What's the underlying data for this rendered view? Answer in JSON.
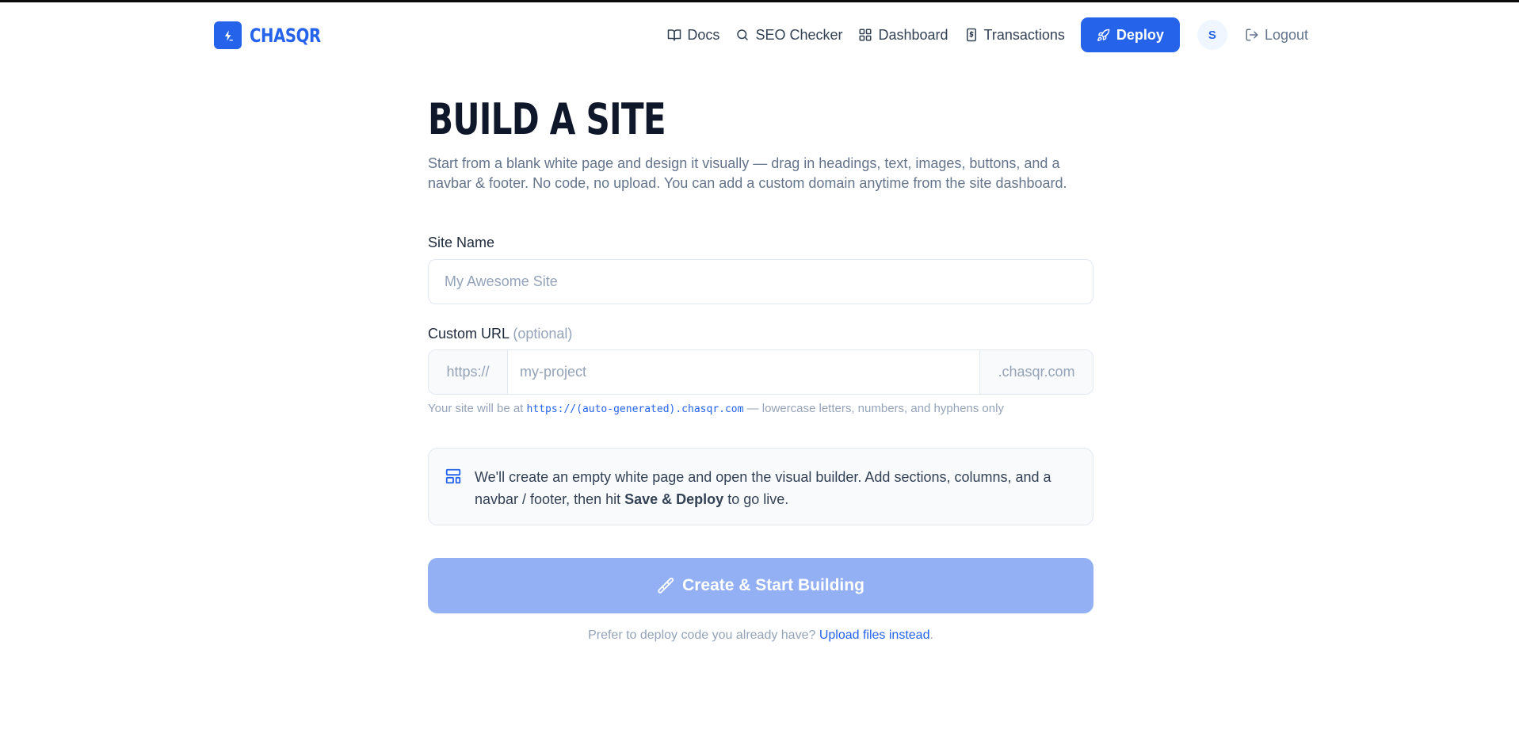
{
  "header": {
    "brand": "CHASQR",
    "nav": {
      "docs": "Docs",
      "seo": "SEO Checker",
      "dashboard": "Dashboard",
      "transactions": "Transactions",
      "deploy": "Deploy",
      "avatar_initial": "S",
      "logout": "Logout"
    }
  },
  "main": {
    "title": "BUILD A SITE",
    "subtitle": "Start from a blank white page and design it visually — drag in headings, text, images, buttons, and a navbar & footer. No code, no upload. You can add a custom domain anytime from the site dashboard.",
    "site_name": {
      "label": "Site Name",
      "placeholder": "My Awesome Site",
      "value": ""
    },
    "custom_url": {
      "label": "Custom URL",
      "optional": "(optional)",
      "prefix": "https://",
      "placeholder": "my-project",
      "value": "",
      "suffix": ".chasqr.com",
      "helper_before": "Your site will be at ",
      "helper_code": "https://(auto-generated).chasqr.com",
      "helper_after": " — lowercase letters, numbers, and hyphens only"
    },
    "info": {
      "text_before": "We'll create an empty white page and open the visual builder. Add sections, columns, and a navbar / footer, then hit ",
      "text_bold": "Save & Deploy",
      "text_after": " to go live."
    },
    "create_button": "Create & Start Building",
    "bottom": {
      "text": "Prefer to deploy code you already have? ",
      "link": "Upload files instead",
      "end": "."
    }
  },
  "colors": {
    "accent": "#2563eb",
    "button_disabled": "#93b0f4",
    "muted_text": "#64748b"
  },
  "icons": {
    "logo": "lightning-terminal-icon",
    "docs": "book-open-icon",
    "seo": "search-icon",
    "dashboard": "layout-grid-icon",
    "transactions": "receipt-icon",
    "deploy": "rocket-icon",
    "logout": "log-out-icon",
    "info": "layout-template-icon",
    "create": "paintbrush-icon"
  }
}
